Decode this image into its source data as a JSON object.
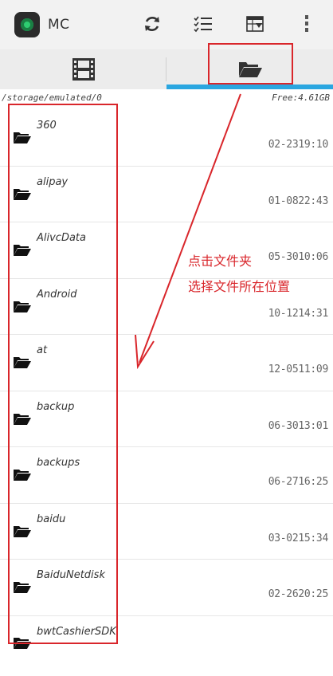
{
  "app": {
    "title": "MC"
  },
  "toolbar": {
    "refresh_icon": "refresh-icon",
    "checklist_icon": "checklist-icon",
    "import_icon": "table-download-icon",
    "more_icon": "more-vertical-icon"
  },
  "tabs": [
    {
      "icon": "film-icon",
      "selected": false
    },
    {
      "icon": "folder-open-icon",
      "selected": true
    }
  ],
  "path": {
    "current": "/storage/emulated/0",
    "free": "Free:4.61GB"
  },
  "files": [
    {
      "name": "360",
      "date": "02-2319:10"
    },
    {
      "name": "alipay",
      "date": "01-0822:43"
    },
    {
      "name": "AlivcData",
      "date": "05-3010:06"
    },
    {
      "name": "Android",
      "date": "10-1214:31"
    },
    {
      "name": "at",
      "date": "12-0511:09"
    },
    {
      "name": "backup",
      "date": "06-3013:01"
    },
    {
      "name": "backups",
      "date": "06-2716:25"
    },
    {
      "name": "baidu",
      "date": "03-0215:34"
    },
    {
      "name": "BaiduNetdisk",
      "date": "02-2620:25"
    },
    {
      "name": "bwtCashierSDK",
      "date": ""
    }
  ],
  "annotation": {
    "line1": "点击文件夹",
    "line2": "选择文件所在位置",
    "color": "#d9262b"
  },
  "colors": {
    "accent": "#2aa6e0",
    "annotation": "#d9262b"
  }
}
